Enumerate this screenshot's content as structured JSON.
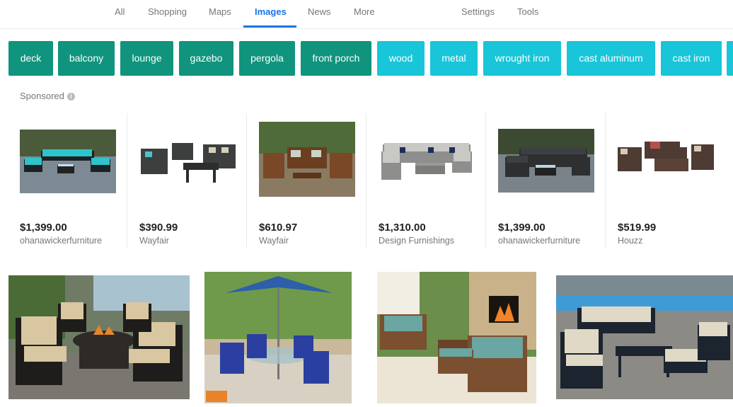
{
  "nav": {
    "tabs": [
      "All",
      "Shopping",
      "Maps",
      "Images",
      "News",
      "More"
    ],
    "active_tab": "Images",
    "settings": "Settings",
    "tools": "Tools"
  },
  "chips": [
    {
      "label": "deck",
      "style": "dark"
    },
    {
      "label": "balcony",
      "style": "dark"
    },
    {
      "label": "lounge",
      "style": "dark"
    },
    {
      "label": "gazebo",
      "style": "dark"
    },
    {
      "label": "pergola",
      "style": "dark"
    },
    {
      "label": "front porch",
      "style": "dark"
    },
    {
      "label": "wood",
      "style": "light"
    },
    {
      "label": "metal",
      "style": "light"
    },
    {
      "label": "wrought iron",
      "style": "light"
    },
    {
      "label": "cast aluminum",
      "style": "light"
    },
    {
      "label": "cast iron",
      "style": "light"
    }
  ],
  "sponsored": {
    "label": "Sponsored",
    "info_icon": "i",
    "products": [
      {
        "price": "$1,399.00",
        "seller": "ohanawickerfurniture",
        "icon": "sectional-teal-image"
      },
      {
        "price": "$390.99",
        "seller": "Wayfair",
        "icon": "chat-set-image"
      },
      {
        "price": "$610.97",
        "seller": "Wayfair",
        "icon": "wood-set-image"
      },
      {
        "price": "$1,310.00",
        "seller": "Design Furnishings",
        "icon": "gray-sectional-image"
      },
      {
        "price": "$1,399.00",
        "seller": "ohanawickerfurniture",
        "icon": "dark-sectional-image"
      },
      {
        "price": "$519.99",
        "seller": "Houzz",
        "icon": "brown-set-image"
      }
    ]
  },
  "colors": {
    "accent": "#1a73e8",
    "chip_dark": "#10947d",
    "chip_light": "#19c5d8"
  }
}
